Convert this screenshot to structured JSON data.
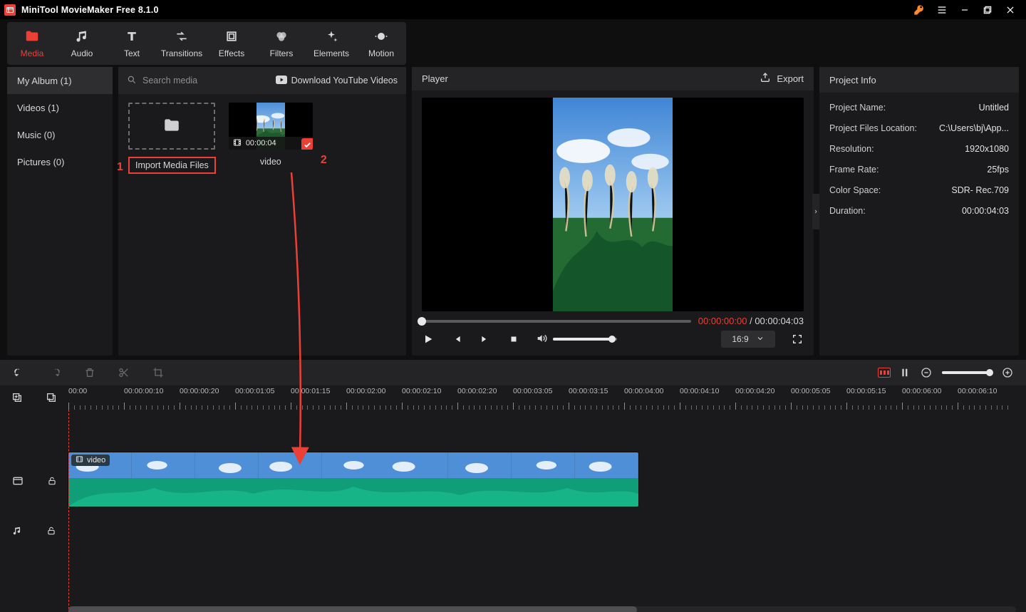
{
  "window": {
    "title": "MiniTool MovieMaker Free 8.1.0"
  },
  "ribbon": [
    {
      "id": "media",
      "label": "Media",
      "active": true
    },
    {
      "id": "audio",
      "label": "Audio",
      "active": false
    },
    {
      "id": "text",
      "label": "Text",
      "active": false
    },
    {
      "id": "transitions",
      "label": "Transitions",
      "active": false
    },
    {
      "id": "effects",
      "label": "Effects",
      "active": false
    },
    {
      "id": "filters",
      "label": "Filters",
      "active": false
    },
    {
      "id": "elements",
      "label": "Elements",
      "active": false
    },
    {
      "id": "motion",
      "label": "Motion",
      "active": false
    }
  ],
  "sidebar": {
    "items": [
      {
        "label": "My Album (1)",
        "active": true
      },
      {
        "label": "Videos (1)",
        "active": false
      },
      {
        "label": "Music (0)",
        "active": false
      },
      {
        "label": "Pictures (0)",
        "active": false
      }
    ]
  },
  "mediaPanel": {
    "searchPlaceholder": "Search media",
    "youtubeLink": "Download YouTube Videos",
    "importLabel": "Import Media Files",
    "clip": {
      "name": "video",
      "duration": "00:00:04"
    },
    "annotation": {
      "n1": "1",
      "n2": "2"
    }
  },
  "player": {
    "title": "Player",
    "exportLabel": "Export",
    "current": "00:00:00:00",
    "total": "00:00:04:03",
    "aspect": "16:9"
  },
  "projectInfo": {
    "title": "Project Info",
    "rows": [
      {
        "k": "Project Name:",
        "v": "Untitled"
      },
      {
        "k": "Project Files Location:",
        "v": "C:\\Users\\bj\\App..."
      },
      {
        "k": "Resolution:",
        "v": "1920x1080"
      },
      {
        "k": "Frame Rate:",
        "v": "25fps"
      },
      {
        "k": "Color Space:",
        "v": "SDR- Rec.709"
      },
      {
        "k": "Duration:",
        "v": "00:00:04:03"
      }
    ]
  },
  "timeline": {
    "rulerLabels": [
      "00:00",
      "00:00:00:10",
      "00:00:00:20",
      "00:00:01:05",
      "00:00:01:15",
      "00:00:02:00",
      "00:00:02:10",
      "00:00:02:20",
      "00:00:03:05",
      "00:00:03:15",
      "00:00:04:00",
      "00:00:04:10",
      "00:00:04:20",
      "00:00:05:05",
      "00:00:05:15",
      "00:00:06:00",
      "00:00:06:10"
    ],
    "clipLabel": "video"
  }
}
